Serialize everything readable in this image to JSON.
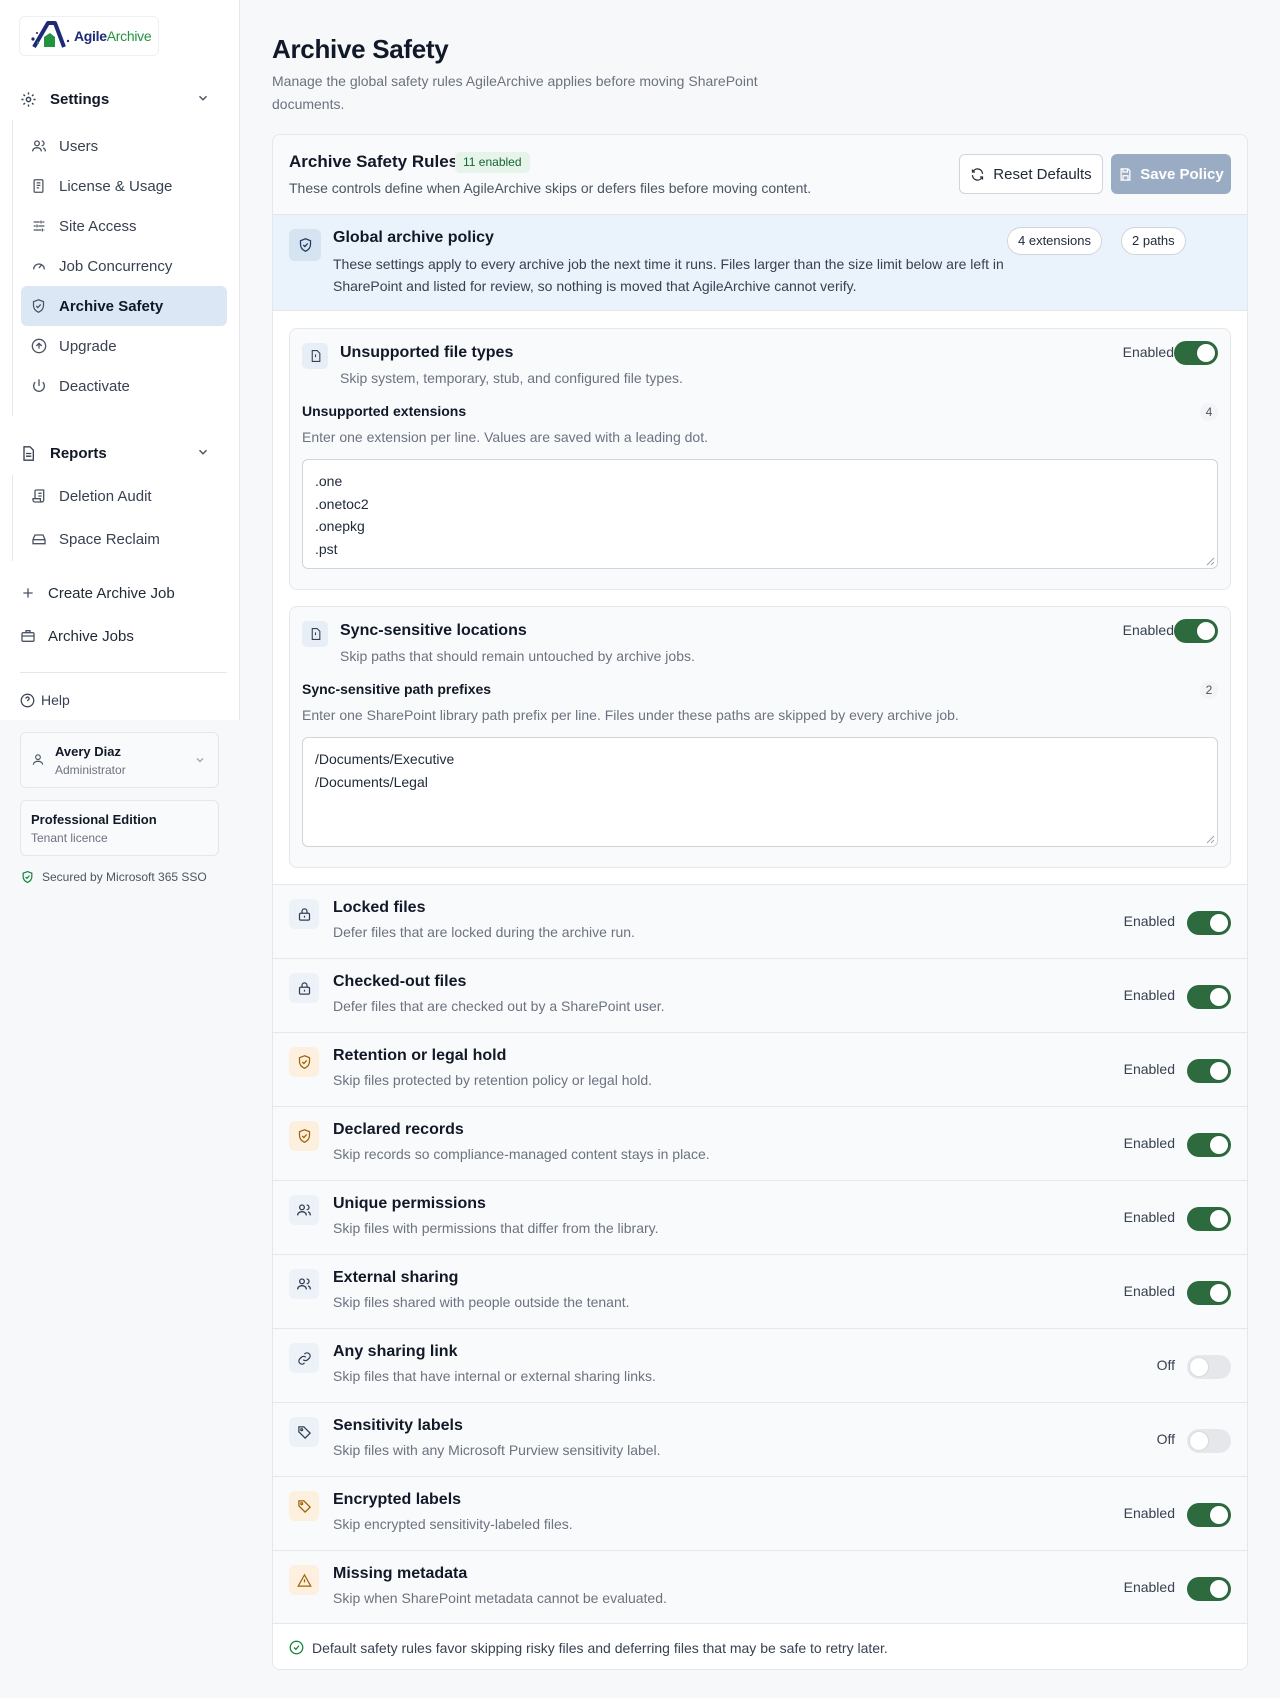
{
  "brand": {
    "agile": "Agile",
    "archive": "Archive"
  },
  "sidebar": {
    "settings_label": "Settings",
    "settings_items": [
      {
        "label": "Users",
        "icon": "users-icon"
      },
      {
        "label": "License & Usage",
        "icon": "document-icon"
      },
      {
        "label": "Site Access",
        "icon": "sliders-icon"
      },
      {
        "label": "Job Concurrency",
        "icon": "gauge-icon"
      },
      {
        "label": "Archive Safety",
        "icon": "shield-icon",
        "active": true
      },
      {
        "label": "Upgrade",
        "icon": "arrow-up-circle-icon"
      },
      {
        "label": "Deactivate",
        "icon": "power-icon"
      }
    ],
    "reports_label": "Reports",
    "reports_items": [
      {
        "label": "Deletion Audit",
        "icon": "scroll-icon"
      },
      {
        "label": "Space Reclaim",
        "icon": "drive-icon"
      }
    ],
    "create_job": "Create Archive Job",
    "archive_jobs": "Archive Jobs",
    "help": "Help",
    "user": {
      "name": "Avery Diaz",
      "role": "Administrator"
    },
    "edition": {
      "title": "Professional Edition",
      "subtitle": "Tenant licence"
    },
    "sso": "Secured by Microsoft 365 SSO"
  },
  "page": {
    "title": "Archive Safety",
    "subtitle": "Manage the global safety rules AgileArchive applies before moving SharePoint documents."
  },
  "card": {
    "title": "Archive Safety Rules",
    "badge": "11 enabled",
    "subtitle": "These controls define when AgileArchive skips or defers files before moving content.",
    "reset_label": "Reset Defaults",
    "save_label": "Save Policy"
  },
  "global": {
    "title": "Global archive policy",
    "description": "These settings apply to every archive job the next time it runs. Files larger than the size limit below are left in SharePoint and listed for review, so nothing is moved that AgileArchive cannot verify.",
    "pill_extensions": "4 extensions",
    "pill_paths": "2 paths"
  },
  "unsupported": {
    "title": "Unsupported file types",
    "description": "Skip system, temporary, stub, and configured file types.",
    "status": "Enabled",
    "enabled": true,
    "field_label": "Unsupported extensions",
    "count": "4",
    "help": "Enter one extension per line. Values are saved with a leading dot.",
    "values": [
      ".one",
      ".onetoc2",
      ".onepkg",
      ".pst"
    ]
  },
  "sync": {
    "title": "Sync-sensitive locations",
    "description": "Skip paths that should remain untouched by archive jobs.",
    "status": "Enabled",
    "enabled": true,
    "field_label": "Sync-sensitive path prefixes",
    "count": "2",
    "help": "Enter one SharePoint library path prefix per line. Files under these paths are skipped by every archive job.",
    "values": [
      "/Documents/Executive",
      "/Documents/Legal"
    ]
  },
  "rules": [
    {
      "title": "Locked files",
      "description": "Defer files that are locked during the archive run.",
      "status": "Enabled",
      "enabled": true,
      "icon": "lock-icon",
      "tone": "blue"
    },
    {
      "title": "Checked-out files",
      "description": "Defer files that are checked out by a SharePoint user.",
      "status": "Enabled",
      "enabled": true,
      "icon": "lock-icon",
      "tone": "blue"
    },
    {
      "title": "Retention or legal hold",
      "description": "Skip files protected by retention policy or legal hold.",
      "status": "Enabled",
      "enabled": true,
      "icon": "shield-icon",
      "tone": "amber"
    },
    {
      "title": "Declared records",
      "description": "Skip records so compliance-managed content stays in place.",
      "status": "Enabled",
      "enabled": true,
      "icon": "shield-icon",
      "tone": "amber"
    },
    {
      "title": "Unique permissions",
      "description": "Skip files with permissions that differ from the library.",
      "status": "Enabled",
      "enabled": true,
      "icon": "users-icon",
      "tone": "blue"
    },
    {
      "title": "External sharing",
      "description": "Skip files shared with people outside the tenant.",
      "status": "Enabled",
      "enabled": true,
      "icon": "users-icon",
      "tone": "blue"
    },
    {
      "title": "Any sharing link",
      "description": "Skip files that have internal or external sharing links.",
      "status": "Off",
      "enabled": false,
      "icon": "link-icon",
      "tone": "blue"
    },
    {
      "title": "Sensitivity labels",
      "description": "Skip files with any Microsoft Purview sensitivity label.",
      "status": "Off",
      "enabled": false,
      "icon": "tag-icon",
      "tone": "blue"
    },
    {
      "title": "Encrypted labels",
      "description": "Skip encrypted sensitivity-labeled files.",
      "status": "Enabled",
      "enabled": true,
      "icon": "tag-icon",
      "tone": "amber"
    },
    {
      "title": "Missing metadata",
      "description": "Skip when SharePoint metadata cannot be evaluated.",
      "status": "Enabled",
      "enabled": true,
      "icon": "warning-icon",
      "tone": "amber"
    }
  ],
  "footer_note": "Default safety rules favor skipping risky files and deferring files that may be safe to retry later."
}
